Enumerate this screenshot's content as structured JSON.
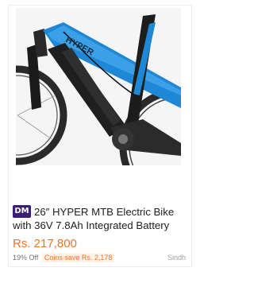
{
  "product": {
    "seller_badge": "DM",
    "title": "26″ HYPER MTB Electric Bike with 36V 7.8Ah Integrated Battery",
    "price": "Rs. 217,800",
    "discount": "19% Off",
    "coins": "Coins save Rs. 2,178",
    "location": "Sindh",
    "image_brand_text": "HYPER"
  },
  "colors": {
    "price": "#f57224",
    "badge_bg": "#3b1e73",
    "frame_blue": "#1e88d6",
    "frame_black": "#222222"
  }
}
